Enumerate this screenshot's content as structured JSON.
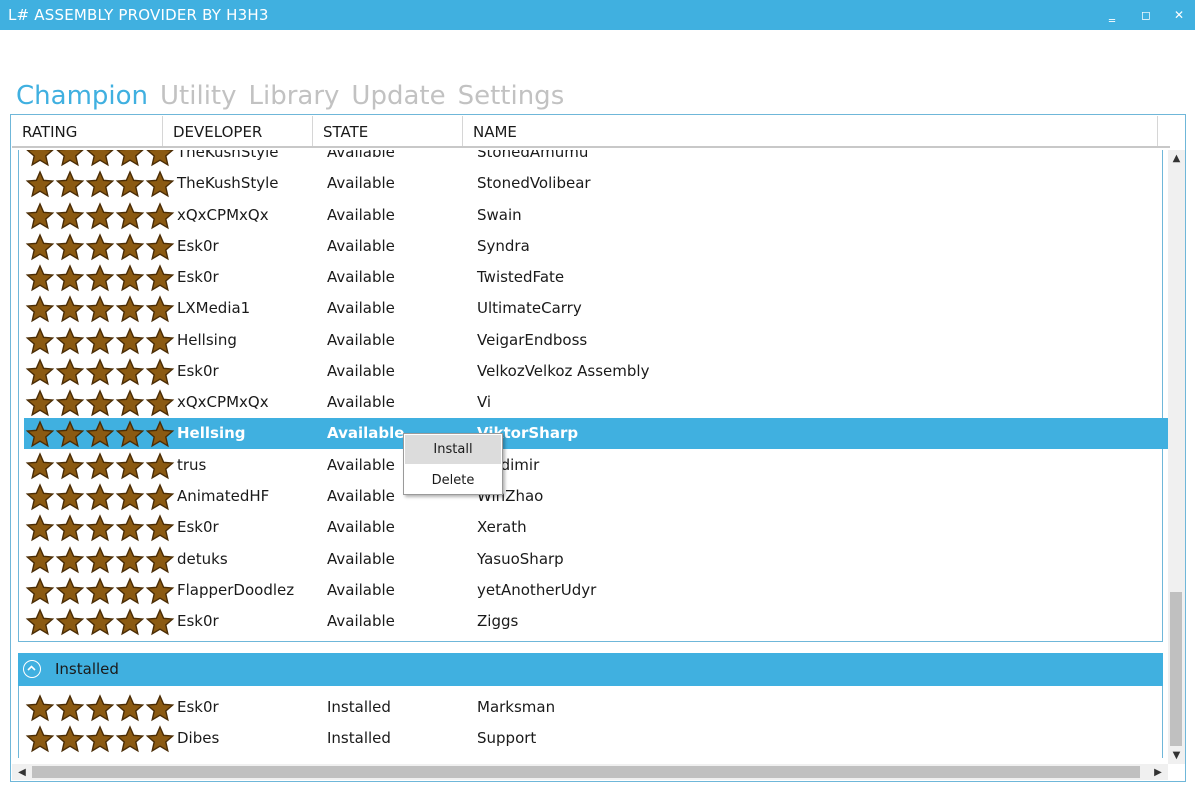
{
  "window": {
    "title": "L# ASSEMBLY PROVIDER BY H3H3",
    "minimize_symbol": "‗",
    "maximize_symbol": "◻",
    "close_symbol": "✕"
  },
  "tabs": [
    {
      "label": "Champion",
      "active": true
    },
    {
      "label": "Utility",
      "active": false
    },
    {
      "label": "Library",
      "active": false
    },
    {
      "label": "Update",
      "active": false
    },
    {
      "label": "Settings",
      "active": false
    }
  ],
  "columns": [
    "RATING",
    "DEVELOPER",
    "STATE",
    "NAME"
  ],
  "rating_stars": 5,
  "available_rows": [
    {
      "developer": "TheKushStyle",
      "state": "Available",
      "name": "StonedAmumu"
    },
    {
      "developer": "TheKushStyle",
      "state": "Available",
      "name": "StonedVolibear"
    },
    {
      "developer": "xQxCPMxQx",
      "state": "Available",
      "name": "Swain"
    },
    {
      "developer": "Esk0r",
      "state": "Available",
      "name": "Syndra"
    },
    {
      "developer": "Esk0r",
      "state": "Available",
      "name": "TwistedFate"
    },
    {
      "developer": "LXMedia1",
      "state": "Available",
      "name": "UltimateCarry"
    },
    {
      "developer": "Hellsing",
      "state": "Available",
      "name": "VeigarEndboss"
    },
    {
      "developer": "Esk0r",
      "state": "Available",
      "name": "VelkozVelkoz Assembly"
    },
    {
      "developer": "xQxCPMxQx",
      "state": "Available",
      "name": "Vi"
    },
    {
      "developer": "Hellsing",
      "state": "Available",
      "name": "ViktorSharp",
      "selected": true
    },
    {
      "developer": "trus",
      "state": "Available",
      "name": "Vladimir"
    },
    {
      "developer": "AnimatedHF",
      "state": "Available",
      "name": "WinZhao"
    },
    {
      "developer": "Esk0r",
      "state": "Available",
      "name": "Xerath"
    },
    {
      "developer": "detuks",
      "state": "Available",
      "name": "YasuoSharp"
    },
    {
      "developer": "FlapperDoodlez",
      "state": "Available",
      "name": "yetAnotherUdyr"
    },
    {
      "developer": "Esk0r",
      "state": "Available",
      "name": "Ziggs"
    }
  ],
  "installed_group": {
    "label": "Installed",
    "rows": [
      {
        "developer": "Esk0r",
        "state": "Installed",
        "name": "Marksman"
      },
      {
        "developer": "Dibes",
        "state": "Installed",
        "name": "Support"
      }
    ]
  },
  "context_menu": {
    "install_label": "Install",
    "delete_label": "Delete"
  },
  "scrollbars": {
    "up_arrow": "▲",
    "down_arrow": "▼",
    "left_arrow": "◀",
    "right_arrow": "▶"
  },
  "colors": {
    "accent": "#40b0e0",
    "inactive_tab": "#c2c2c2",
    "star_fill": "#8b5a12",
    "star_outline": "#4a2c05"
  },
  "icons": {
    "rating": "star-icon",
    "group_toggle": "collapse-up-icon"
  }
}
